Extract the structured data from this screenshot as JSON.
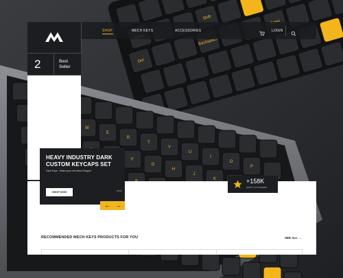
{
  "brand": {
    "logo_icon": "logo-m-icon"
  },
  "nav": {
    "links": [
      {
        "label": "SHOP",
        "active": true
      },
      {
        "label": "MECH KEYS",
        "active": false
      },
      {
        "label": "ACCESSORIES",
        "active": false
      }
    ],
    "cart_icon": "cart-icon",
    "login_label": "LOGIN",
    "search_icon": "search-icon"
  },
  "bestseller": {
    "number": "2",
    "label_line1": "Best",
    "label_line2": "Seller"
  },
  "hero": {
    "title": "HEAVY INDUSTRY DARK CUSTOM KEYCAPS SET",
    "subtitle": "Dark Keys - Make your Life More Elegant",
    "button_label": "SHOP NOW",
    "counter": "02/03",
    "prev_icon": "arrow-left-icon",
    "next_icon": "arrow-right-icon"
  },
  "stats": {
    "value": "+158K",
    "label": "HAPPY CUSTOMERS",
    "icon": "star-icon"
  },
  "recommended": {
    "title": "RECOMMENDED MECH KEYS PRODUCTS FOR YOU",
    "see_all_label": "SEE ALL"
  },
  "keycap_legends": [
    "Enter",
    "Shift",
    "Alt",
    "Control",
    "Del",
    "Backspace",
    "Enter",
    "Q",
    "W",
    "E",
    "R",
    "T",
    "Y",
    "U",
    "I",
    "O",
    "P",
    "A",
    "S",
    "D",
    "F",
    "G",
    "H",
    "J",
    "K",
    "L",
    "Z",
    "X",
    "C",
    "V",
    "B",
    "N",
    "M"
  ],
  "colors": {
    "accent": "#f2b51c",
    "dark": "#1c1e21",
    "white": "#ffffff"
  }
}
